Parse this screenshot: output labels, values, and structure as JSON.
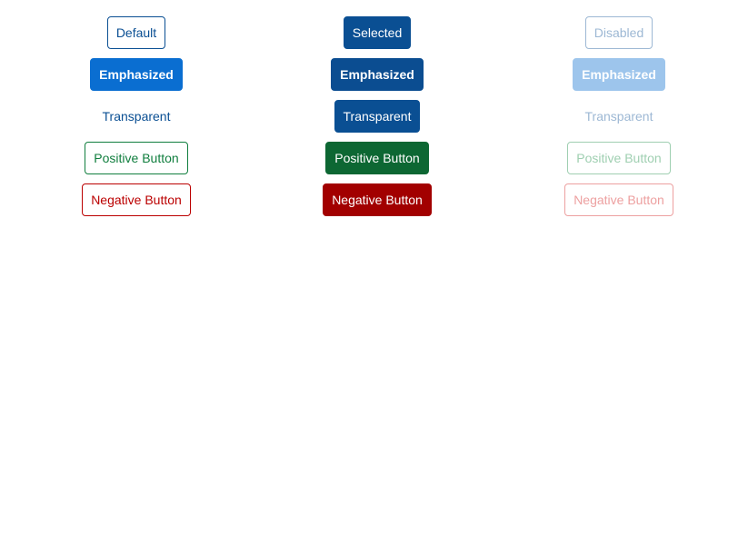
{
  "columns": {
    "normal": {
      "default_label": "Default",
      "emphasized_label": "Emphasized",
      "transparent_label": "Transparent",
      "positive_label": "Positive Button",
      "negative_label": "Negative Button"
    },
    "selected": {
      "default_label": "Selected",
      "emphasized_label": "Emphasized",
      "transparent_label": "Transparent",
      "positive_label": "Positive Button",
      "negative_label": "Negative Button"
    },
    "disabled": {
      "default_label": "Disabled",
      "emphasized_label": "Emphasized",
      "transparent_label": "Transparent",
      "positive_label": "Positive Button",
      "negative_label": "Negative Button"
    }
  },
  "colors": {
    "brand_blue": "#0a4f93",
    "emphasized_blue": "#0a6ed1",
    "positive_green": "#107e3e",
    "negative_red": "#bb0000"
  }
}
